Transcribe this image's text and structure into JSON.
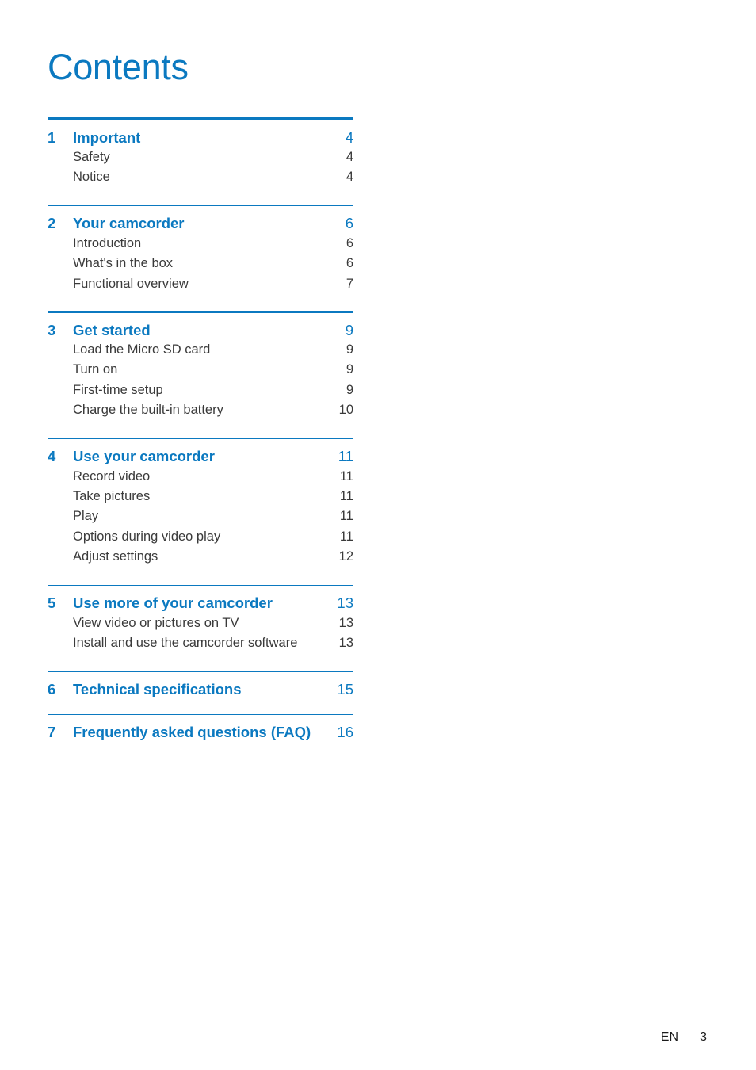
{
  "document": {
    "title": "Contents",
    "accent_color": "#0b79c0",
    "body_color": "#3a3a3a"
  },
  "toc": {
    "sections": [
      {
        "number": "1",
        "label": "Important",
        "page": "4",
        "entries": [
          {
            "label": "Safety",
            "page": "4"
          },
          {
            "label": "Notice",
            "page": "4"
          }
        ]
      },
      {
        "number": "2",
        "label": "Your camcorder",
        "page": "6",
        "entries": [
          {
            "label": "Introduction",
            "page": "6"
          },
          {
            "label": "What's in the box",
            "page": "6"
          },
          {
            "label": "Functional overview",
            "page": "7"
          }
        ]
      },
      {
        "number": "3",
        "label": "Get started",
        "page": "9",
        "entries": [
          {
            "label": "Load the Micro SD card",
            "page": "9"
          },
          {
            "label": "Turn on",
            "page": "9"
          },
          {
            "label": "First-time setup",
            "page": "9"
          },
          {
            "label": "Charge the built-in battery",
            "page": "10"
          }
        ]
      },
      {
        "number": "4",
        "label": "Use your camcorder",
        "page": "11",
        "entries": [
          {
            "label": "Record video",
            "page": "11"
          },
          {
            "label": "Take pictures",
            "page": "11"
          },
          {
            "label": "Play",
            "page": "11"
          },
          {
            "label": "Options during video play",
            "page": "11"
          },
          {
            "label": "Adjust settings",
            "page": "12"
          }
        ]
      },
      {
        "number": "5",
        "label": "Use more of your camcorder",
        "page": "13",
        "entries": [
          {
            "label": "View video or pictures on TV",
            "page": "13"
          },
          {
            "label": "Install and use the camcorder software",
            "page": "13"
          }
        ]
      },
      {
        "number": "6",
        "label": "Technical specifications",
        "page": "15",
        "entries": []
      },
      {
        "number": "7",
        "label": "Frequently asked questions (FAQ)",
        "page": "16",
        "entries": []
      }
    ]
  },
  "footer": {
    "language": "EN",
    "folio": "3"
  }
}
